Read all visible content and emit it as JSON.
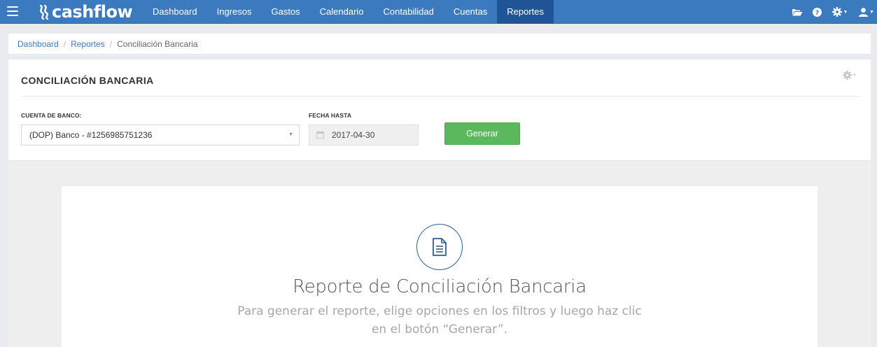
{
  "app": {
    "logo_text": "cashflow"
  },
  "topnav": {
    "items": [
      {
        "label": "Dashboard"
      },
      {
        "label": "Ingresos"
      },
      {
        "label": "Gastos"
      },
      {
        "label": "Calendario"
      },
      {
        "label": "Contabilidad"
      },
      {
        "label": "Cuentas"
      },
      {
        "label": "Reportes",
        "active": true
      }
    ],
    "icons": [
      "folder-open-icon",
      "help-icon",
      "gear-icon",
      "user-icon"
    ]
  },
  "breadcrumb": {
    "items": [
      "Dashboard",
      "Reportes"
    ],
    "current": "Conciliación Bancaria"
  },
  "panel": {
    "title": "CONCILIACIÓN BANCARIA",
    "filters": {
      "bank_account_label": "CUENTA DE BANCO:",
      "bank_account_value": "(DOP) Banco - #1256985751236",
      "date_label": "FECHA HASTA",
      "date_value": "2017-04-30",
      "generate_label": "Generar"
    }
  },
  "report": {
    "title": "Reporte de Conciliación Bancaria",
    "description": "Para generar el reporte, elige opciones en los filtros y luego haz clic en el botón “Generar”."
  },
  "colors": {
    "nav_bg": "#3c7ac0",
    "nav_active": "#1f5596",
    "link": "#3c7ac0",
    "button_green": "#5cb85c",
    "icon_circle": "#2e5f8f"
  }
}
